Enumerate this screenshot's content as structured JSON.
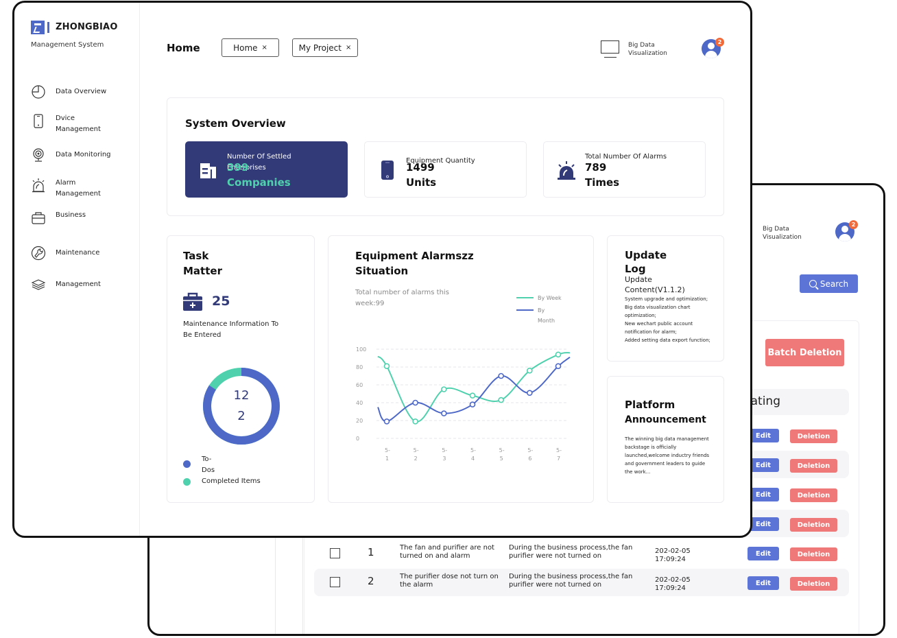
{
  "back_window": {
    "header": {
      "big_data_label_line1": "Big Data",
      "big_data_label_line2": "Visualization",
      "notification_count": "2"
    },
    "search_button": "Search",
    "batch_delete_button": "Batch Deletion",
    "operating_header": "Operating",
    "row_actions": {
      "edit": "Edit",
      "delete": "Deletion"
    },
    "rows": [
      {
        "index": "1",
        "title": "The fan and purifier are not turned on and alarm",
        "description": "During the business process,the fan purifier were not turned on",
        "date": "202-02-05",
        "time": "17:09:24"
      },
      {
        "index": "2",
        "title": "The purifier dose not turn on the alarm",
        "description": "During the business process,the fan purifier were not turned on",
        "date": "202-02-05",
        "time": "17:09:24"
      }
    ]
  },
  "sidebar": {
    "brand": "ZHONGBIAO",
    "subtitle": "Management System",
    "active_item": "Alarm Management",
    "items": [
      {
        "label": "Data Overview",
        "icon": "pie-chart-icon"
      },
      {
        "label": "Dvice Management",
        "icon": "phone-device-icon"
      },
      {
        "label": "Data Monitoring",
        "icon": "webcam-icon"
      },
      {
        "label": "Alarm Management",
        "icon": "alarm-siren-icon"
      },
      {
        "label": "Business",
        "icon": "briefcase-icon"
      },
      {
        "label": "Maintenance",
        "icon": "wrench-icon"
      },
      {
        "label": "Management",
        "icon": "layers-icon"
      }
    ]
  },
  "header": {
    "title": "Home",
    "tabs": [
      {
        "label": "Home",
        "close": "×"
      },
      {
        "label": "My Project",
        "close": "×"
      }
    ],
    "big_data_label_line1": "Big Data",
    "big_data_label_line2": "Visualization",
    "notification_count": "2"
  },
  "overview": {
    "title": "System Overview",
    "stats": [
      {
        "label": "Number Of Settled Enterprises",
        "value": "399",
        "unit": "Companies",
        "icon": "building-icon"
      },
      {
        "label": "Equipment Quantity",
        "value": "1499",
        "unit": "Units",
        "icon": "phone-device-icon"
      },
      {
        "label": "Total Number Of Alarms",
        "value": "789",
        "unit": "Times",
        "icon": "alarm-siren-icon"
      }
    ]
  },
  "task": {
    "title_line1": "Task",
    "title_line2": "Matter",
    "count": "25",
    "description": "Maintenance Information To Be Entered",
    "donut_line1": "12",
    "donut_line2": "2",
    "todo_fraction": 0.84,
    "completed_fraction": 0.16,
    "legend": [
      {
        "label": "To-Dos",
        "color": "#4d68c7"
      },
      {
        "label": "Completed Items",
        "color": "#4fd1ad"
      }
    ]
  },
  "alarms": {
    "title_line1": "Equipment Alarmszz",
    "title_line2": "Situation",
    "subtitle": "Total number of alarms this week:99"
  },
  "update_log": {
    "title_line1": "Update",
    "title_line2": "Log",
    "heading": "Update Content(V1.1.2)",
    "entries": [
      "System upgrade and optimization;",
      "Big data visualization chart optimization;",
      "New wechart public account notification for alarm;",
      "Added setting data export function;"
    ]
  },
  "announcement": {
    "title_line1": "Platform",
    "title_line2": "Announcement",
    "body": "The winning big data management backstage is officially launched,welcome inductry friends and government leaders to guide the work..."
  },
  "colors": {
    "primary": "#4d68c7",
    "navy": "#323a78",
    "accent_green": "#4fd1ad",
    "danger": "#ef7878",
    "badge": "#f06a3a"
  },
  "chart_data": {
    "type": "line",
    "title": "Equipment Alarmszz Situation",
    "categories": [
      "5-1",
      "5-2",
      "5-3",
      "5-4",
      "5-5",
      "5-6",
      "5-7"
    ],
    "yticks": [
      0,
      20,
      40,
      60,
      80,
      100
    ],
    "ylim": [
      0,
      100
    ],
    "grid": true,
    "legend_position": "top-right",
    "smooth": true,
    "series": [
      {
        "name": "By Week",
        "color": "#4fd1ad",
        "values": [
          81,
          19,
          55,
          48,
          43,
          76,
          94
        ],
        "lead_in": 92,
        "lead_out": 96
      },
      {
        "name": "By Month",
        "color": "#4d68c7",
        "values": [
          19,
          40,
          28,
          38,
          70,
          51,
          81
        ],
        "lead_in": 35,
        "lead_out": 91
      }
    ]
  }
}
